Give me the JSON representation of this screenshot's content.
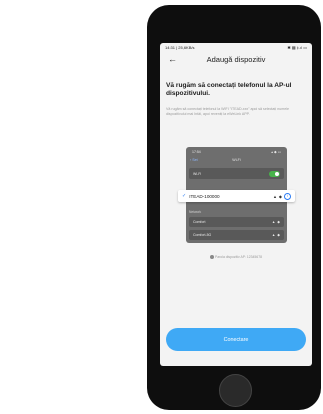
{
  "status_bar": {
    "left": "14:31 | 25,6KB/s",
    "right": "✱ ▦ ‡.ıl ▭"
  },
  "header": {
    "back_icon": "arrow-left-icon",
    "title": "Adaugă dispozitiv"
  },
  "heading": "Vă rugăm să conectați telefonul la AP-ul dispozitivului.",
  "description": "Vă rugăm să conectați telefonul la WIFI \"ITEAD-xxx\" apoi să selectați numele dispozitivului mai întâi, apoi reveniți la eWeLink APP.",
  "illustration": {
    "status_left": "17:54",
    "status_right": "▴ ◆ ▭",
    "nav_back": "‹ Set",
    "nav_title": "Wi-Fi",
    "wifi_label": "Wi-Fi",
    "selected_network": "ITEAD-100000",
    "section_label": "Network",
    "network1": "Comfort",
    "network2": "Comfort-5G"
  },
  "password_hint": "Parola dispozitiv AP: 12345678",
  "connect_button": "Conectare",
  "colors": {
    "accent": "#3fa9f5",
    "toggle": "#47b34a"
  }
}
